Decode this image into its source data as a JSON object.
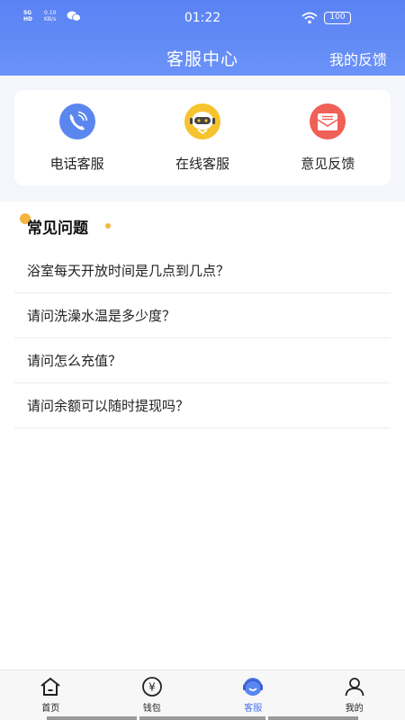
{
  "status_bar": {
    "signal": "5G HD",
    "net_speed": "0.10 KB/s",
    "time": "01:22",
    "battery": "100"
  },
  "header": {
    "title": "客服中心",
    "action": "我的反馈"
  },
  "services": [
    {
      "label": "电话客服",
      "icon": "phone-icon",
      "color": "#5b86f0"
    },
    {
      "label": "在线客服",
      "icon": "robot-icon",
      "color": "#f7c32e"
    },
    {
      "label": "意见反馈",
      "icon": "mail-icon",
      "color": "#ef6056"
    }
  ],
  "faq": {
    "title": "常见问题",
    "items": [
      "浴室每天开放时间是几点到几点？",
      "请问洗澡水温是多少度？",
      "请问怎么充值？",
      "请问余额可以随时提现吗？"
    ]
  },
  "tabbar": {
    "items": [
      {
        "label": "首页",
        "icon": "home-icon",
        "active": false
      },
      {
        "label": "钱包",
        "icon": "wallet-icon",
        "active": false
      },
      {
        "label": "客服",
        "icon": "service-icon",
        "active": true
      },
      {
        "label": "我的",
        "icon": "profile-icon",
        "active": false
      }
    ]
  },
  "colors": {
    "header": "#5a82f3",
    "accent": "#4a73ea",
    "faq_dot": "#f5b53f"
  }
}
